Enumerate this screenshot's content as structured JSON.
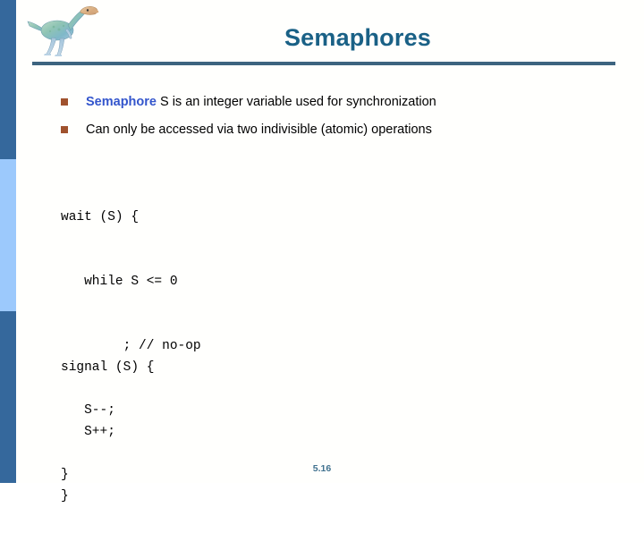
{
  "slide": {
    "title": "Semaphores",
    "page_number": "5.16",
    "logo_icon": "dinosaur-icon",
    "colors": {
      "title": "#1a6186",
      "rule": "#3d6480",
      "stripe_dark": "#35689c",
      "stripe_light": "#9cc9fc",
      "bullet_marker": "#a0522d",
      "keyword_blue": "#3355cc",
      "footer": "#41728f",
      "background": "#fffffd"
    }
  },
  "bullets": [
    {
      "marker": "square",
      "lead": "Semaphore",
      "rest": " S is an integer variable used for synchronization"
    },
    {
      "marker": "square",
      "lead": "",
      "rest": "Can only be accessed via two indivisible (atomic) operations"
    }
  ],
  "code_blocks": [
    {
      "name": "wait",
      "lines": [
        "wait (S) {",
        "   while S <= 0",
        "        ; // no-op",
        "   S--;",
        "}"
      ]
    },
    {
      "name": "signal",
      "lines": [
        "signal (S) {",
        "   S++;",
        "}"
      ]
    }
  ]
}
